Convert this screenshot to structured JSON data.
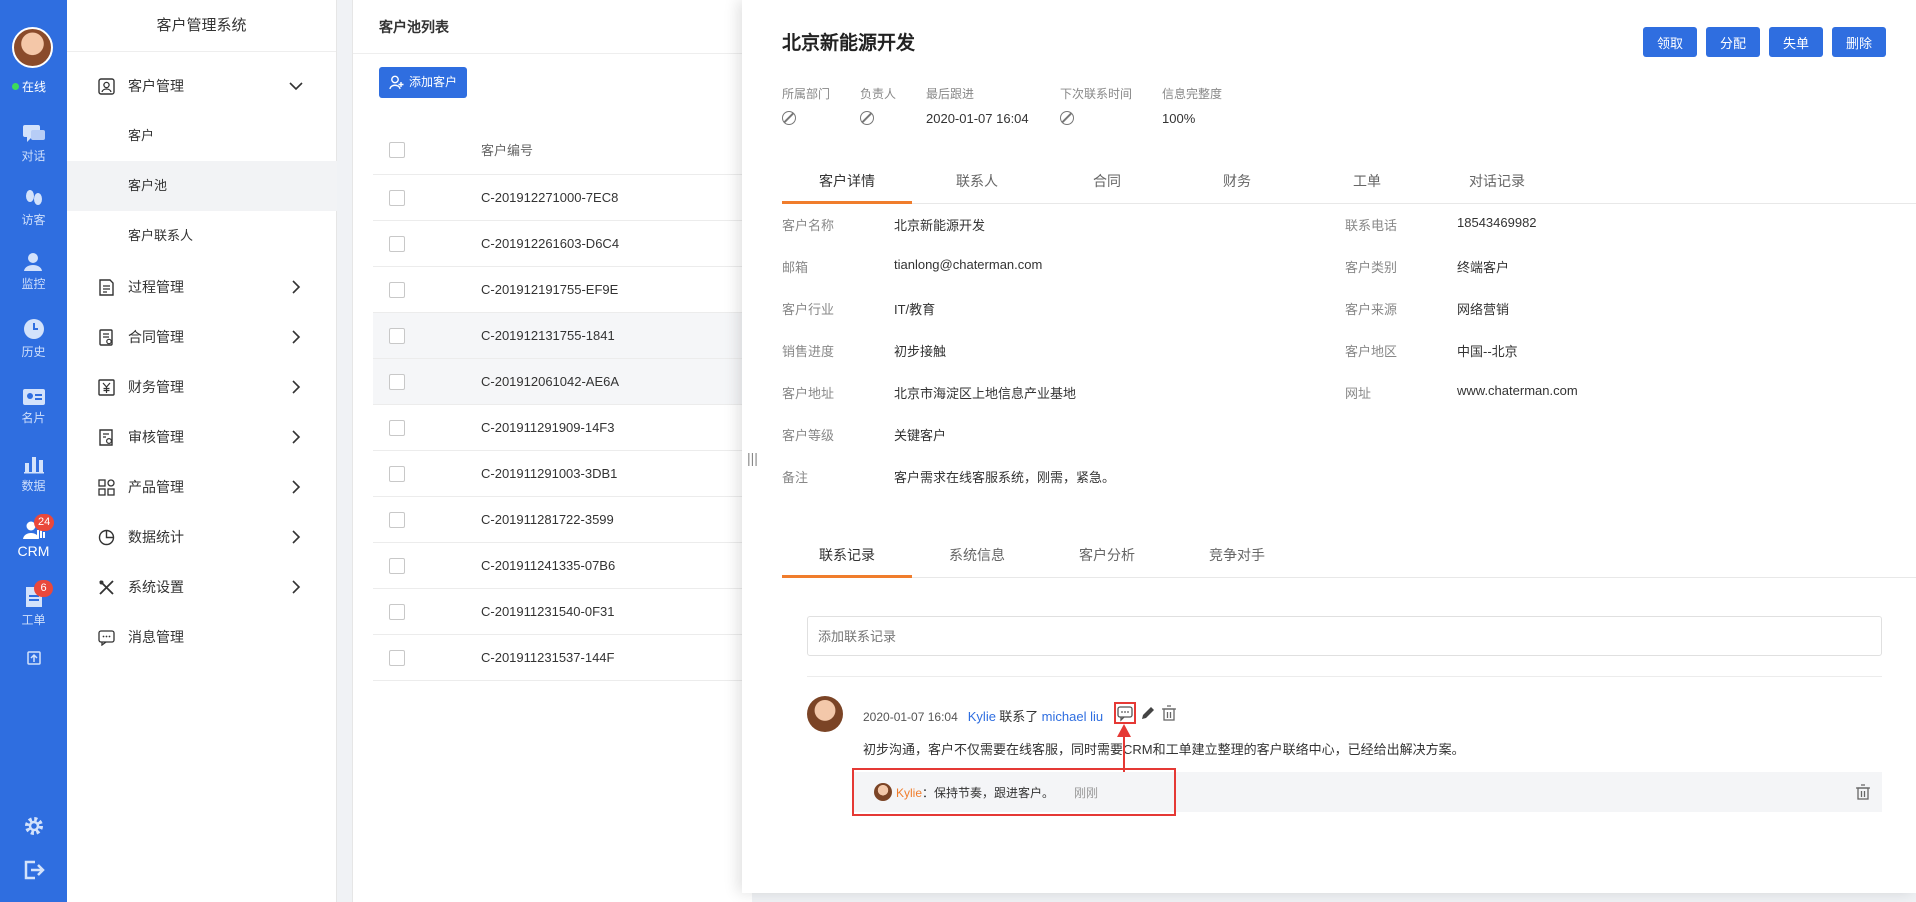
{
  "rail": {
    "status": "在线",
    "items": [
      {
        "label": "对话",
        "icon": "chat-icon"
      },
      {
        "label": "访客",
        "icon": "footprint-icon"
      },
      {
        "label": "监控",
        "icon": "monitor-user-icon"
      },
      {
        "label": "历史",
        "icon": "clock-icon"
      },
      {
        "label": "名片",
        "icon": "id-card-icon"
      },
      {
        "label": "数据",
        "icon": "bar-chart-icon"
      },
      {
        "label": "CRM",
        "icon": "crm-icon",
        "badge": "24"
      },
      {
        "label": "工单",
        "icon": "document-icon",
        "badge": "6"
      }
    ]
  },
  "menu": {
    "title": "客户管理系统",
    "items": [
      {
        "label": "客户管理",
        "icon": "customer-icon"
      },
      {
        "label": "过程管理",
        "icon": "process-icon"
      },
      {
        "label": "合同管理",
        "icon": "contract-icon"
      },
      {
        "label": "财务管理",
        "icon": "finance-icon"
      },
      {
        "label": "审核管理",
        "icon": "audit-icon"
      },
      {
        "label": "产品管理",
        "icon": "product-icon"
      },
      {
        "label": "数据统计",
        "icon": "pie-chart-icon"
      },
      {
        "label": "系统设置",
        "icon": "tools-icon"
      },
      {
        "label": "消息管理",
        "icon": "message-icon"
      }
    ],
    "sub": [
      "客户",
      "客户池",
      "客户联系人"
    ]
  },
  "list": {
    "title": "客户池列表",
    "add_label": "添加客户",
    "col_header": "客户编号",
    "rows": [
      "C-201912271000-7EC8",
      "C-201912261603-D6C4",
      "C-201912191755-EF9E",
      "C-201912131755-1841",
      "C-201912061042-AE6A",
      "C-201911291909-14F3",
      "C-201911291003-3DB1",
      "C-201911281722-3599",
      "C-201911241335-07B6",
      "C-201911231540-0F31",
      "C-201911231537-144F"
    ]
  },
  "detail": {
    "title": "北京新能源开发",
    "buttons": [
      "领取",
      "分配",
      "失单",
      "删除"
    ],
    "meta": {
      "dept": "所属部门",
      "owner": "负责人",
      "last_label": "最后跟进",
      "last_value": "2020-01-07 16:04",
      "next_label": "下次联系时间",
      "complete_label": "信息完整度",
      "complete_value": "100%"
    },
    "tabs": [
      "客户详情",
      "联系人",
      "合同",
      "财务",
      "工单",
      "对话记录"
    ],
    "left_fields": [
      {
        "k": "客户名称",
        "v": "北京新能源开发"
      },
      {
        "k": "邮箱",
        "v": "tianlong@chaterman.com"
      },
      {
        "k": "客户行业",
        "v": "IT/教育"
      },
      {
        "k": "销售进度",
        "v": "初步接触"
      },
      {
        "k": "客户地址",
        "v": "北京市海淀区上地信息产业基地"
      },
      {
        "k": "客户等级",
        "v": "关键客户"
      },
      {
        "k": "备注",
        "v": "客户需求在线客服系统，刚需，紧急。"
      }
    ],
    "right_fields": [
      {
        "k": "联系电话",
        "v": "18543469982"
      },
      {
        "k": "客户类别",
        "v": "终端客户"
      },
      {
        "k": "客户来源",
        "v": "网络营销"
      },
      {
        "k": "客户地区",
        "v": "中国--北京"
      },
      {
        "k": "网址",
        "v": "www.chaterman.com"
      }
    ],
    "tabs2": [
      "联系记录",
      "系统信息",
      "客户分析",
      "竞争对手"
    ],
    "record_placeholder": "添加联系记录",
    "record": {
      "time": "2020-01-07 16:04",
      "user": "Kylie",
      "verb": "联系了",
      "contact": "michael liu",
      "body": "初步沟通，客户不仅需要在线客服，同时需要CRM和工单建立整理的客户联络中心，已经给出解决方案。"
    },
    "reply": {
      "user": "Kylie",
      "sep": "：",
      "text": "保持节奏，跟进客户。",
      "time": "刚刚"
    }
  },
  "colors": {
    "primary": "#2f6ee0",
    "accent": "#f07d2c",
    "highlight": "#e53935"
  }
}
